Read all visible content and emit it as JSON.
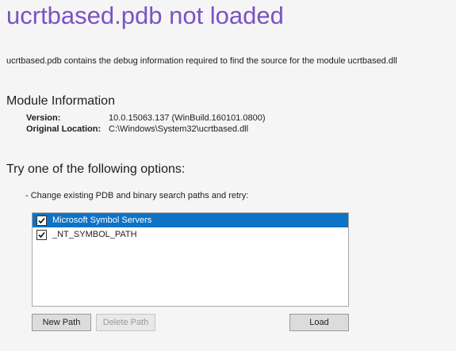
{
  "header": {
    "title": "ucrtbased.pdb not loaded",
    "description": "ucrtbased.pdb contains the debug information required to find the source for the module ucrtbased.dll"
  },
  "module_info": {
    "heading": "Module Information",
    "rows": [
      {
        "label": "Version:",
        "value": "10.0.15063.137 (WinBuild.160101.0800)"
      },
      {
        "label": "Original Location:",
        "value": "C:\\Windows\\System32\\ucrtbased.dll"
      }
    ]
  },
  "options": {
    "heading": "Try one of the following options:",
    "item": "-  Change existing PDB and binary search paths and retry:"
  },
  "paths": {
    "items": [
      {
        "label": "Microsoft Symbol Servers",
        "checked": true,
        "selected": true
      },
      {
        "label": "_NT_SYMBOL_PATH",
        "checked": true,
        "selected": false
      }
    ]
  },
  "buttons": {
    "new_path": "New Path",
    "delete_path": "Delete Path",
    "load": "Load"
  },
  "colors": {
    "title": "#7b52c6",
    "selection": "#0e72c6"
  }
}
